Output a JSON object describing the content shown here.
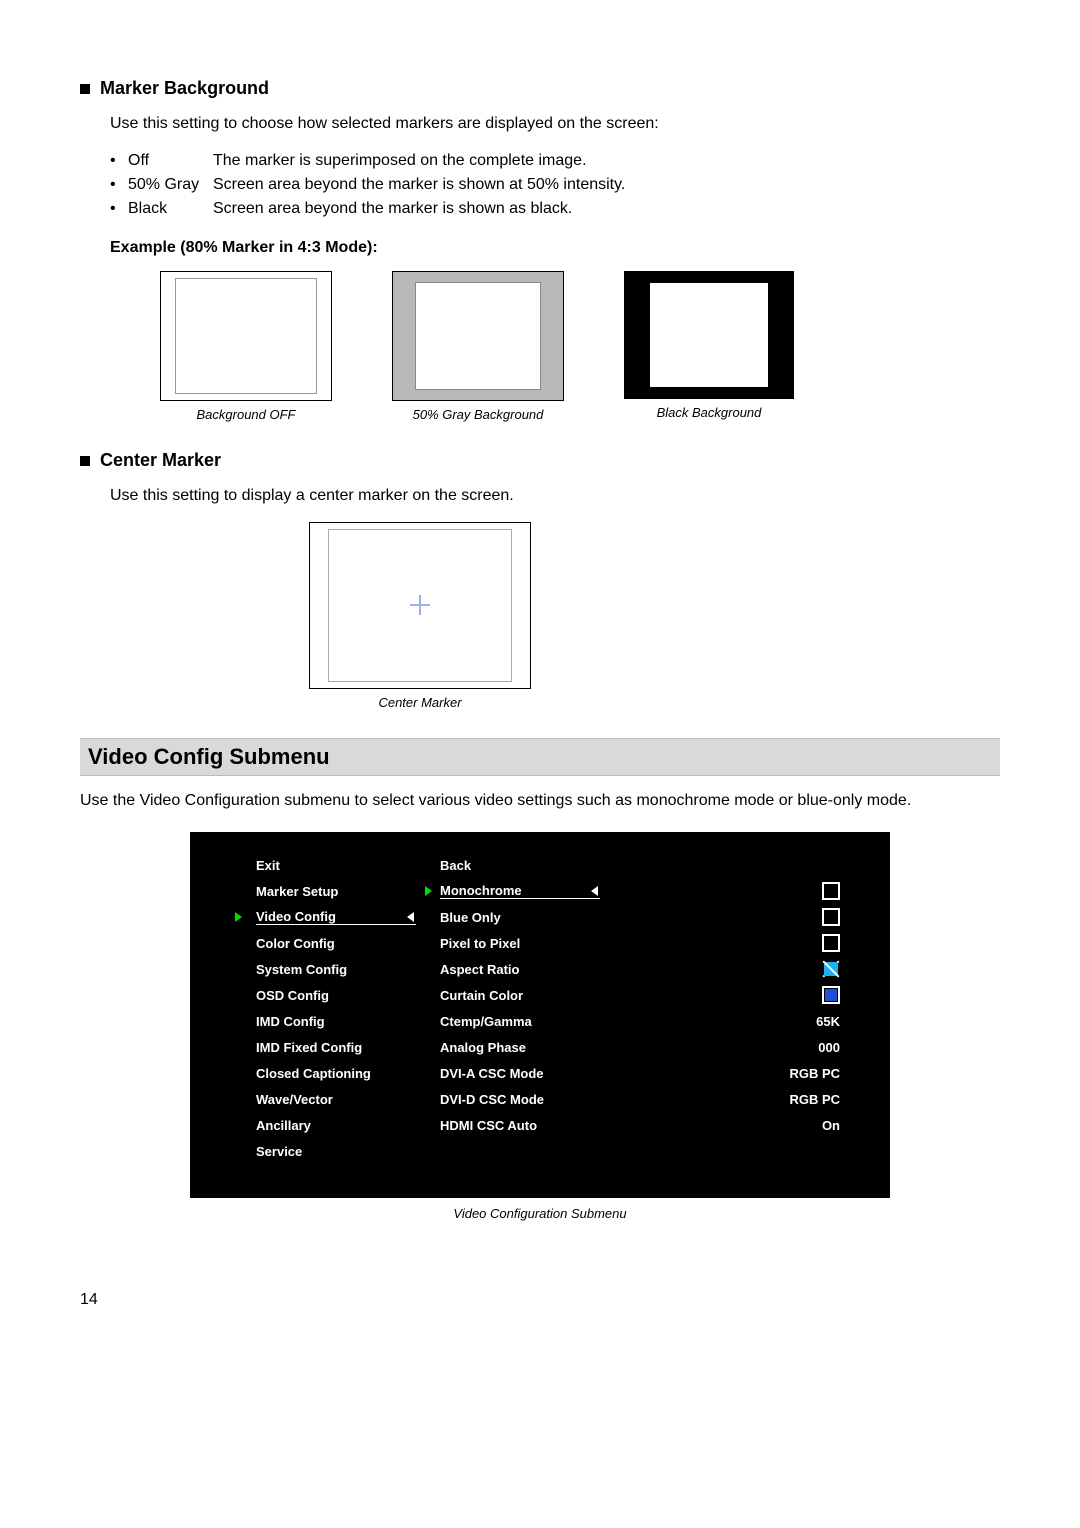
{
  "sections": {
    "marker_bg": {
      "title": "Marker Background",
      "intro": "Use this setting to choose how selected markers are displayed on the screen:",
      "bullets": [
        {
          "key": "Off",
          "text": "The marker is superimposed on the complete image."
        },
        {
          "key": "50% Gray",
          "text": "Screen area beyond the marker is shown at 50% intensity."
        },
        {
          "key": "Black",
          "text": "Screen area beyond the marker is shown as black."
        }
      ],
      "example_label": "Example (80% Marker in 4:3 Mode):",
      "captions": {
        "off": "Background OFF",
        "gray": "50% Gray Background",
        "black": "Black Background"
      }
    },
    "center_marker": {
      "title": "Center Marker",
      "intro": "Use this setting to display a center marker on the screen.",
      "caption": "Center Marker"
    },
    "video_config": {
      "heading": "Video Config Submenu",
      "intro": "Use the Video Configuration submenu to select various video settings such as monochrome mode or blue-only mode.",
      "caption": "Video Configuration Submenu"
    }
  },
  "osd": {
    "left": [
      "Exit",
      "Marker Setup",
      "Video Config",
      "Color Config",
      "System Config",
      "OSD Config",
      "IMD Config",
      "IMD Fixed Config",
      "Closed Captioning",
      "Wave/Vector",
      "Ancillary",
      "Service"
    ],
    "right_labels": [
      "Back",
      "Monochrome",
      "Blue Only",
      "Pixel to Pixel",
      "Aspect Ratio",
      "Curtain Color",
      "Ctemp/Gamma",
      "Analog Phase",
      "DVI-A CSC Mode",
      "DVI-D CSC Mode",
      "HDMI CSC Auto"
    ],
    "values": {
      "ctemp": "65K",
      "phase": "000",
      "dvia": "RGB PC",
      "dvid": "RGB PC",
      "hdmi": "On"
    }
  },
  "page_number": "14"
}
